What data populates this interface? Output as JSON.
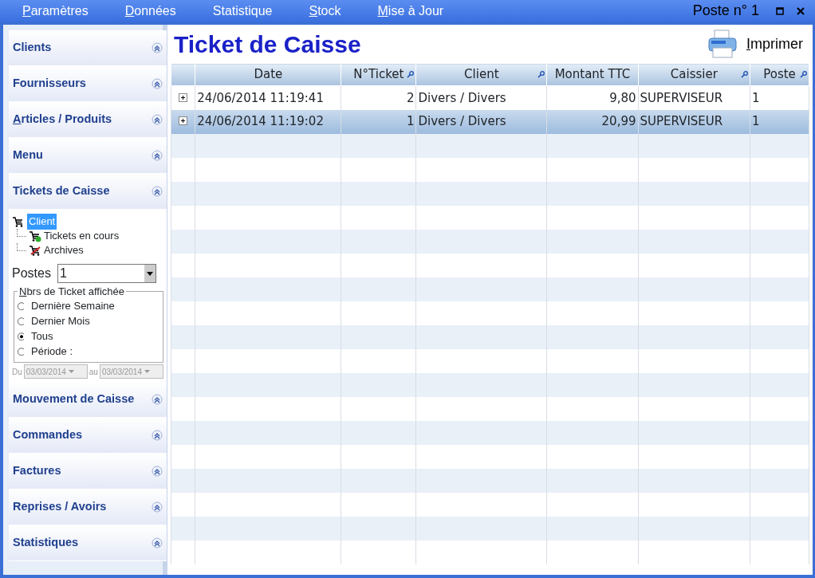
{
  "menu": [
    {
      "label": "Paramètres",
      "mnemonic": true
    },
    {
      "label": "Données",
      "mnemonic": true
    },
    {
      "label": "Statistique",
      "mnemonic": false
    },
    {
      "label": "Stock",
      "mnemonic": true
    },
    {
      "label": "Mise à Jour",
      "mnemonic": true
    }
  ],
  "window": {
    "title": "Poste n° 1"
  },
  "sidebar": {
    "sections": [
      {
        "label": "Clients",
        "mnemonic": false,
        "expanded": false
      },
      {
        "label": "Fournisseurs",
        "mnemonic": false,
        "expanded": false
      },
      {
        "label": "Articles / Produits",
        "mnemonic": true,
        "expanded": false
      },
      {
        "label": "Menu",
        "mnemonic": false,
        "expanded": false
      },
      {
        "label": "Tickets de Caisse",
        "mnemonic": false,
        "expanded": true
      },
      {
        "label": "Mouvement de Caisse",
        "mnemonic": false,
        "expanded": false
      },
      {
        "label": "Commandes",
        "mnemonic": false,
        "expanded": false
      },
      {
        "label": "Factures",
        "mnemonic": false,
        "expanded": false
      },
      {
        "label": "Reprises / Avoirs",
        "mnemonic": false,
        "expanded": false
      },
      {
        "label": "Statistiques",
        "mnemonic": false,
        "expanded": false
      }
    ],
    "tree": {
      "label": "Client",
      "selected": true,
      "children": [
        {
          "label": "Tickets en cours",
          "kind": "current",
          "selected": false
        },
        {
          "label": "Archives",
          "kind": "archive",
          "selected": false
        }
      ]
    },
    "postes": {
      "label": "Postes",
      "value": "1"
    },
    "filter": {
      "legend": "Nbrs de Ticket affichée",
      "mnemonic": true,
      "options": [
        {
          "label": "Dernière Semaine",
          "selected": false
        },
        {
          "label": "Dernier Mois",
          "selected": false
        },
        {
          "label": "Tous",
          "selected": true
        },
        {
          "label": "Période :",
          "selected": false
        }
      ]
    },
    "dates": {
      "from_label": "Du",
      "from": "03/03/2014",
      "to_label": "au",
      "to": "03/03/2014",
      "disabled": true
    }
  },
  "main": {
    "title": "Ticket de Caisse",
    "print_button": {
      "label": "Imprimer",
      "mnemonic": true
    }
  },
  "table": {
    "columns": [
      {
        "label": "Date",
        "searchable": false
      },
      {
        "label": "N°Ticket",
        "searchable": true
      },
      {
        "label": "Client",
        "searchable": true
      },
      {
        "label": "Montant TTC",
        "searchable": false
      },
      {
        "label": "Caissier",
        "searchable": true
      },
      {
        "label": "Poste",
        "searchable": true
      }
    ],
    "rows": [
      {
        "cells": [
          "24/06/2014 11:19:41",
          "2",
          "Divers / Divers",
          "9,80",
          "SUPERVISEUR",
          "1"
        ],
        "selected": false
      },
      {
        "cells": [
          "24/06/2014 11:19:02",
          "1",
          "Divers / Divers",
          "20,99",
          "SUPERVISEUR",
          "1"
        ],
        "selected": true
      }
    ]
  }
}
